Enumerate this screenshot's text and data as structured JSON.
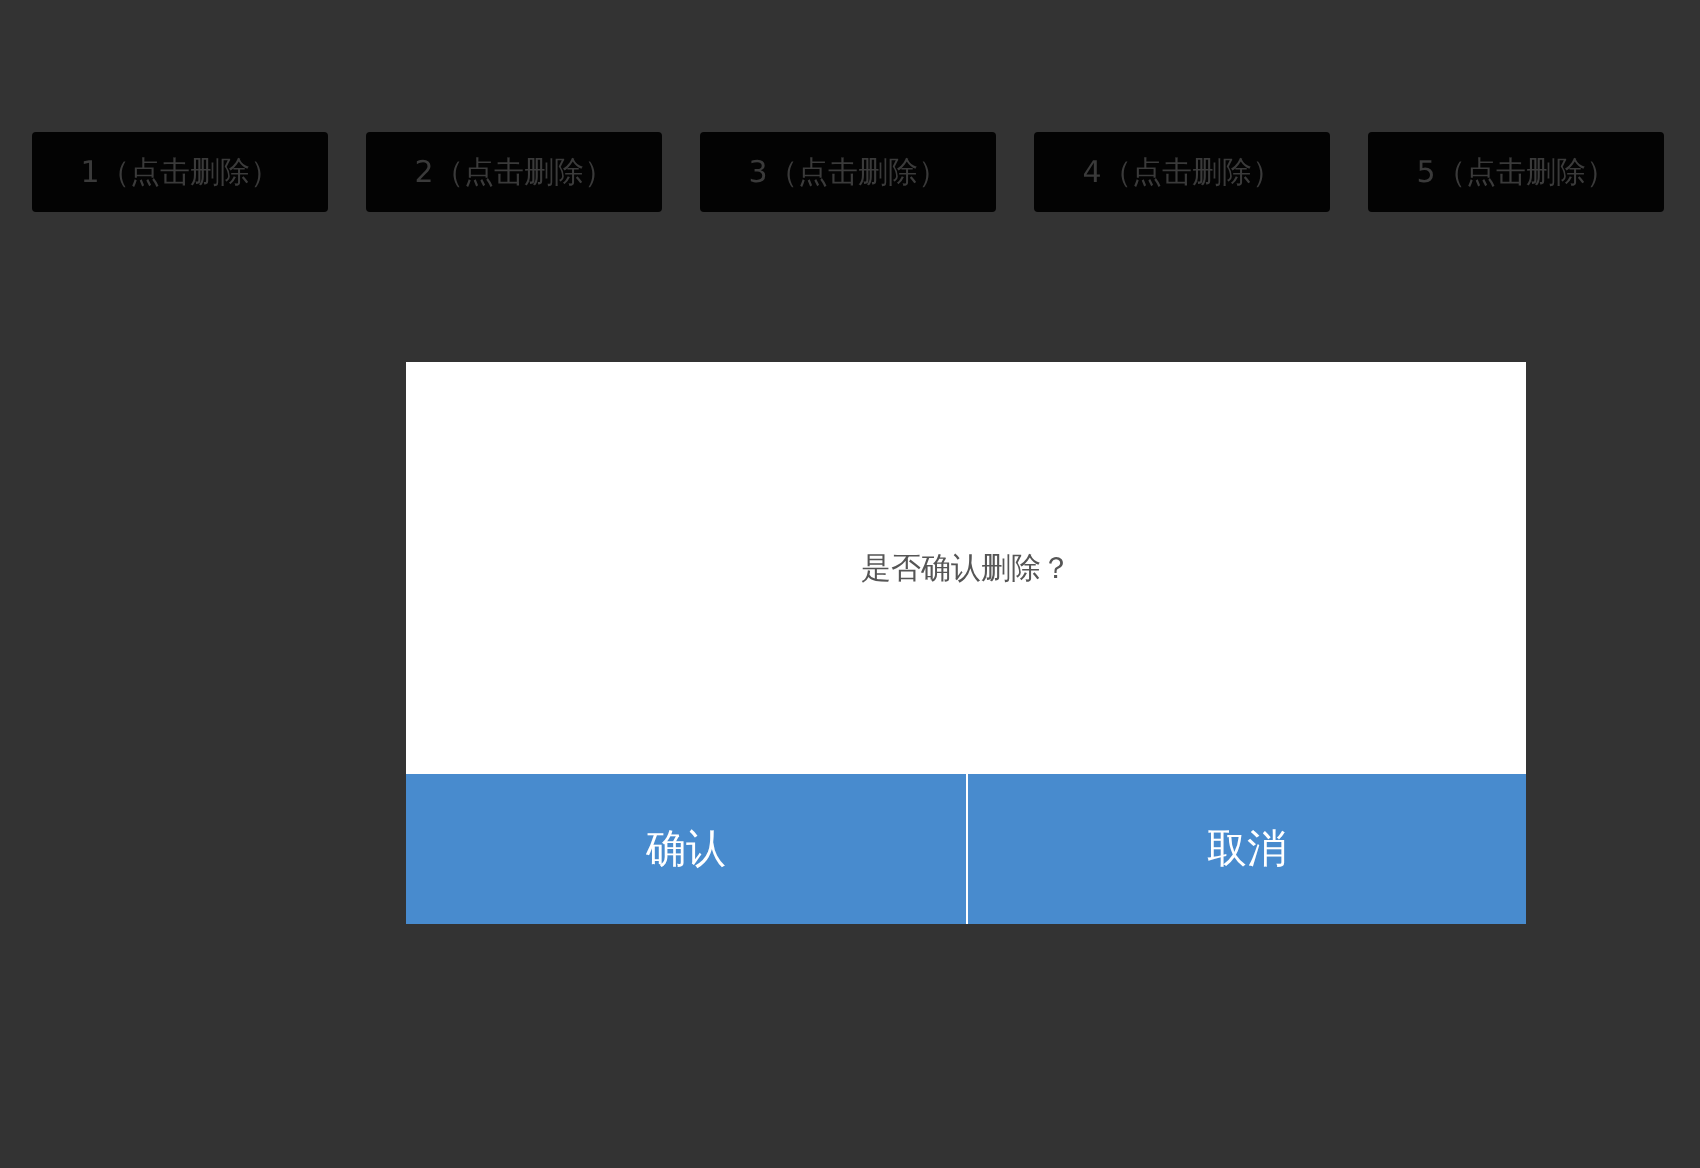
{
  "items": [
    {
      "label": "1（点击删除）"
    },
    {
      "label": "2（点击删除）"
    },
    {
      "label": "3（点击删除）"
    },
    {
      "label": "4（点击删除）"
    },
    {
      "label": "5（点击删除）"
    }
  ],
  "dialog": {
    "message": "是否确认删除？",
    "buttons": [
      {
        "label": "确认"
      },
      {
        "label": "取消"
      }
    ]
  }
}
